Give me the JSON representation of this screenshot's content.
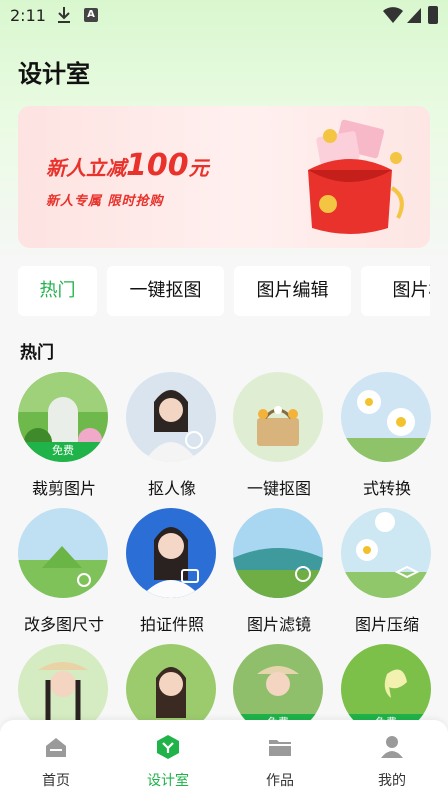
{
  "status_bar": {
    "time": "2:11",
    "a_glyph": "A"
  },
  "page_title": "设计室",
  "banner": {
    "headline_prefix": "新人立减",
    "headline_amount": "100",
    "headline_unit": "元",
    "subline": "新人专属  限时抢购"
  },
  "tabs": [
    {
      "label": "热门",
      "active": true
    },
    {
      "label": "一键抠图"
    },
    {
      "label": "图片编辑"
    },
    {
      "label": "图片格"
    }
  ],
  "section_title": "热门",
  "free_label": "免费",
  "items": [
    {
      "label": "裁剪图片",
      "free": true,
      "icon": "crop-icon"
    },
    {
      "label": "抠人像",
      "icon": "portrait-cutout-icon"
    },
    {
      "label": "一键抠图",
      "icon": "cutout-icon"
    },
    {
      "label": "式转换",
      "icon": "format-convert-icon"
    },
    {
      "label": "改多图尺寸",
      "icon": "resize-icon"
    },
    {
      "label": "拍证件照",
      "icon": "camera-icon"
    },
    {
      "label": "图片滤镜",
      "icon": "filter-icon"
    },
    {
      "label": "图片压缩",
      "icon": "compress-icon"
    },
    {
      "label": "",
      "icon": "portrait-icon"
    },
    {
      "label": "",
      "icon": "portrait-icon"
    },
    {
      "label": "",
      "free": true,
      "icon": "portrait-icon"
    },
    {
      "label": "",
      "free": true,
      "icon": "butterfly-icon"
    }
  ],
  "bottom_nav": [
    {
      "label": "首页",
      "icon": "home-icon"
    },
    {
      "label": "设计室",
      "icon": "design-icon",
      "active": true
    },
    {
      "label": "作品",
      "icon": "folder-icon"
    },
    {
      "label": "我的",
      "icon": "profile-icon"
    }
  ],
  "colors": {
    "accent": "#1fb34a",
    "banner_red": "#e8322b"
  }
}
